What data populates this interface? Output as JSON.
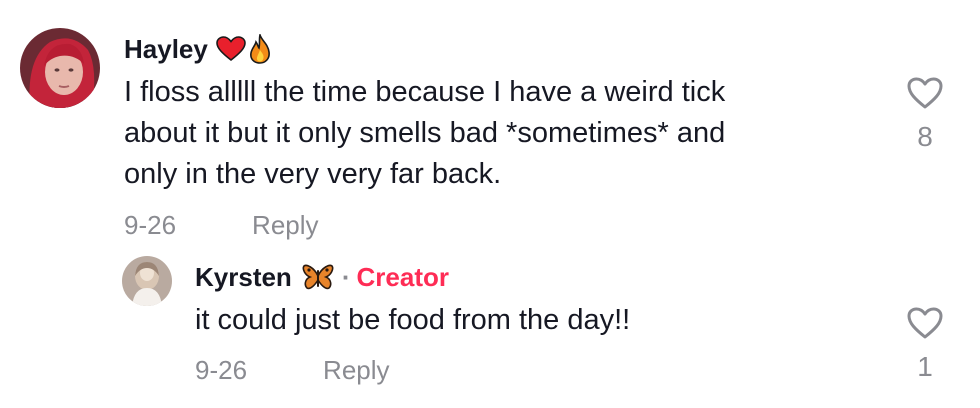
{
  "comments": [
    {
      "username": "Hayley",
      "text_lines": [
        "I floss alllll the time because I have a weird tick",
        "about it but it only smells bad *sometimes* and",
        "only in the very very far back."
      ],
      "date": "9-26",
      "reply_label": "Reply",
      "likes": "8",
      "username_icons": [
        "heart-emoji-icon",
        "fire-emoji-icon"
      ]
    },
    {
      "username": "Kyrsten",
      "username_icons": [
        "butterfly-emoji-icon"
      ],
      "separator": "·",
      "badge": "Creator",
      "text_lines": [
        "it could just be food from the day!!"
      ],
      "date": "9-26",
      "reply_label": "Reply",
      "likes": "1"
    }
  ],
  "colors": {
    "text": "#161823",
    "muted": "#8a8b91",
    "creator": "#fe2c55"
  }
}
